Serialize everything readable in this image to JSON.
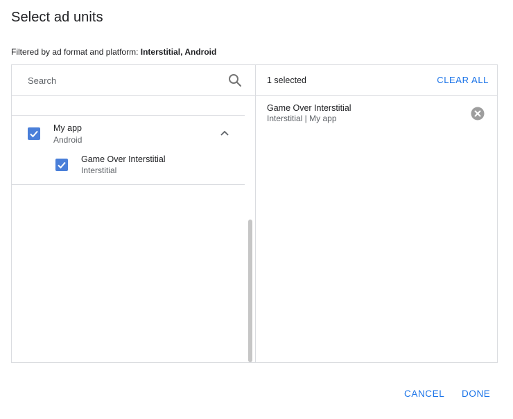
{
  "dialog": {
    "title": "Select ad units",
    "filter_prefix": "Filtered by ad format and platform:",
    "filter_value": "Interstitial, Android"
  },
  "search": {
    "placeholder": "Search",
    "value": "",
    "icon": "search-icon"
  },
  "app_list": {
    "apps": [
      {
        "name": "My app",
        "platform": "Android",
        "checked": true,
        "expanded": true,
        "ad_units": [
          {
            "name": "Game Over Interstitial",
            "format": "Interstitial",
            "checked": true
          }
        ]
      }
    ]
  },
  "selection": {
    "count_label": "1 selected",
    "clear_all_label": "CLEAR ALL",
    "items": [
      {
        "name": "Game Over Interstitial",
        "detail": "Interstitial | My app"
      }
    ]
  },
  "actions": {
    "cancel_label": "CANCEL",
    "done_label": "DONE"
  },
  "colors": {
    "accent": "#1a73e8",
    "checkbox": "#4a7fd9",
    "border": "#dadce0",
    "secondary_text": "#5f6368",
    "remove_icon": "#9e9e9e"
  }
}
